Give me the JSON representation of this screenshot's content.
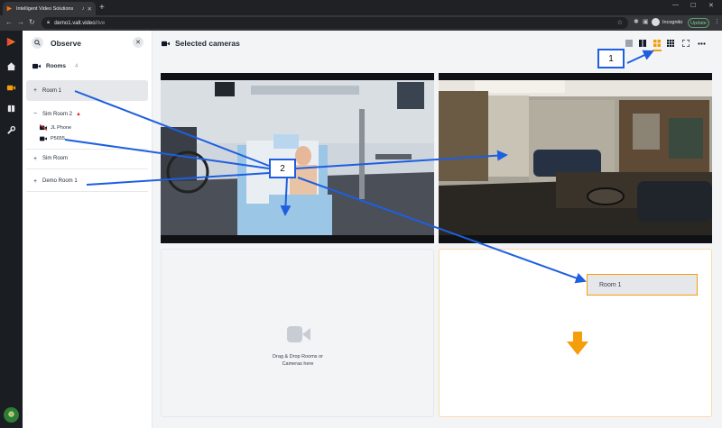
{
  "browser": {
    "tab_title": "Intelligent Video Solutions",
    "url_host": "demo1.valt.video",
    "url_path": "/live",
    "profile_label": "Incognito",
    "update_label": "Update",
    "icons": [
      "back-icon",
      "forward-icon",
      "reload-icon",
      "lock-icon",
      "star-icon",
      "extensions-icon",
      "sidepanel-icon",
      "menu-icon"
    ]
  },
  "rail": {
    "icons": [
      "logo-icon",
      "home-icon",
      "video-icon",
      "book-icon",
      "wrench-icon"
    ],
    "active_index": 2
  },
  "panel": {
    "title": "Observe",
    "rooms_label": "Rooms",
    "rooms_count": "4",
    "rooms": [
      {
        "name": "Room 1",
        "toggle": "+"
      },
      {
        "name": "Sim Room 2",
        "toggle": "−",
        "warning": true,
        "cameras": [
          {
            "name": "JL Phone",
            "status": "disabled"
          },
          {
            "name": "P5655",
            "status": "ok"
          }
        ]
      },
      {
        "name": "Sim Room",
        "toggle": "+"
      },
      {
        "name": "Demo Room 1",
        "toggle": "+"
      }
    ]
  },
  "main": {
    "title": "Selected cameras",
    "layout_options": [
      "single-layout",
      "split-layout",
      "quad-layout",
      "grid-9-layout",
      "fullscreen",
      "more"
    ],
    "active_layout": "quad-layout",
    "drop_hint_line1": "Drag & Drop Rooms or",
    "drop_hint_line2": "Cameras here",
    "drag_chip_label": "Room 1"
  },
  "annotations": {
    "callout_1": "1",
    "callout_2": "2"
  },
  "colors": {
    "accent": "#f59e0b",
    "arrow_blue": "#1d5fe0",
    "warning": "#dc2626"
  }
}
